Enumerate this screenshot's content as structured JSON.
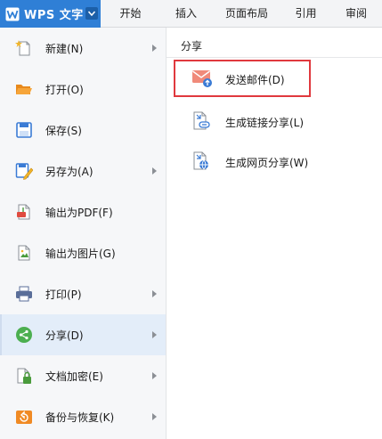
{
  "app": {
    "title": "WPS 文字",
    "brand_color": "#2f7fd6"
  },
  "ribbon": {
    "tabs": [
      {
        "label": "开始"
      },
      {
        "label": "插入"
      },
      {
        "label": "页面布局"
      },
      {
        "label": "引用"
      },
      {
        "label": "审阅"
      }
    ]
  },
  "menu": {
    "items": [
      {
        "label": "新建(N)",
        "icon": "new-document-icon",
        "has_submenu": true
      },
      {
        "label": "打开(O)",
        "icon": "folder-open-icon",
        "has_submenu": false
      },
      {
        "label": "保存(S)",
        "icon": "save-icon",
        "has_submenu": false
      },
      {
        "label": "另存为(A)",
        "icon": "save-as-icon",
        "has_submenu": true
      },
      {
        "label": "输出为PDF(F)",
        "icon": "export-pdf-icon",
        "has_submenu": false
      },
      {
        "label": "输出为图片(G)",
        "icon": "export-image-icon",
        "has_submenu": false
      },
      {
        "label": "打印(P)",
        "icon": "print-icon",
        "has_submenu": true
      },
      {
        "label": "分享(D)",
        "icon": "share-icon",
        "has_submenu": true,
        "active": true
      },
      {
        "label": "文档加密(E)",
        "icon": "encrypt-document-icon",
        "has_submenu": true
      },
      {
        "label": "备份与恢复(K)",
        "icon": "backup-restore-icon",
        "has_submenu": true
      }
    ]
  },
  "share_panel": {
    "header": "分享",
    "items": [
      {
        "label": "发送邮件(D)",
        "icon": "email-send-icon",
        "highlighted": true
      },
      {
        "label": "生成链接分享(L)",
        "icon": "link-share-icon"
      },
      {
        "label": "生成网页分享(W)",
        "icon": "webpage-share-icon"
      }
    ],
    "highlight_color": "#e0393e"
  }
}
